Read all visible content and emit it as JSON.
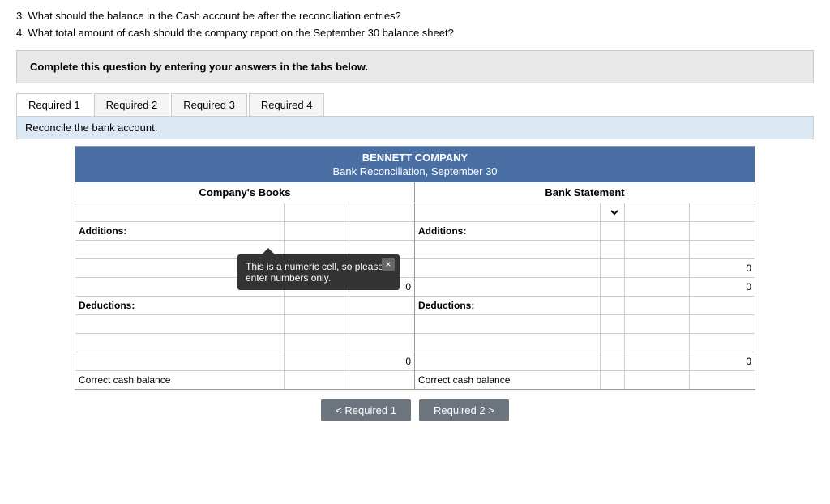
{
  "instructions": {
    "line3": "3. What should the balance in the Cash account be after the reconciliation entries?",
    "line4": "4. What total amount of cash should the company report on the September 30 balance sheet?"
  },
  "banner": {
    "text": "Complete this question by entering your answers in the tabs below."
  },
  "tabs": [
    {
      "label": "Required 1",
      "active": true
    },
    {
      "label": "Required 2",
      "active": false
    },
    {
      "label": "Required 3",
      "active": false
    },
    {
      "label": "Required 4",
      "active": false
    }
  ],
  "reconcile_label": "Reconcile the bank account.",
  "table": {
    "title": "BENNETT COMPANY",
    "subtitle": "Bank Reconciliation, September 30",
    "books_header": "Company's Books",
    "bank_header": "Bank Statement",
    "additions_label": "Additions:",
    "deductions_label_books": "Deductions:",
    "deductions_label_bank": "Deductions:",
    "correct_cash_books": "Correct cash balance",
    "correct_cash_bank": "Correct cash balance",
    "books_totals": [
      "0",
      "0"
    ],
    "bank_totals": [
      "0",
      "0"
    ]
  },
  "tooltip": {
    "message": "This is a numeric cell, so please enter numbers only.",
    "close": "×"
  },
  "nav": {
    "prev_label": "< Required 1",
    "next_label": "Required 2 >"
  }
}
